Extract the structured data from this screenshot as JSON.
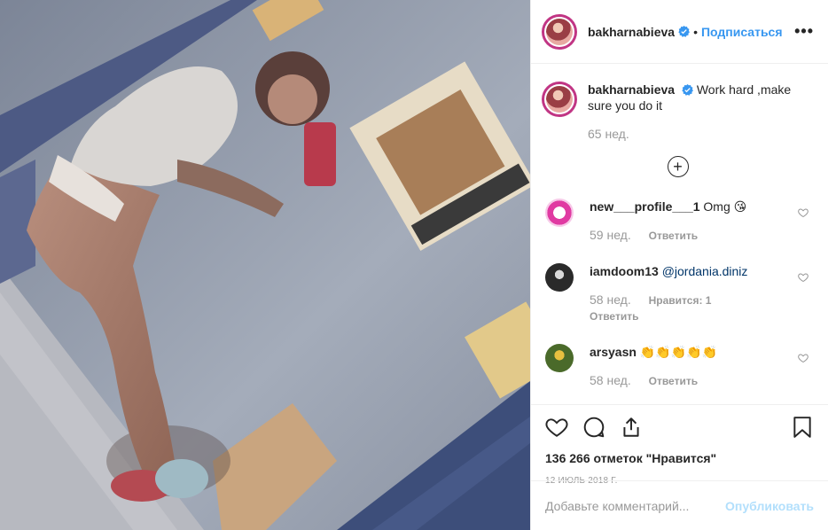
{
  "post": {
    "author": "bakharnabieva",
    "follow_label": "Подписаться",
    "more_label": "•••",
    "separator": "•",
    "caption": "Work hard ,make sure you do it",
    "caption_time": "65 нед.",
    "load_more_label": "+"
  },
  "comments": [
    {
      "user": "new___profile___1",
      "text": "Omg 😘",
      "time": "59 нед.",
      "reply_label": "Ответить",
      "likes_label": "",
      "avatar_color": "#e03aa2"
    },
    {
      "user": "iamdoom13",
      "text": "@jordania.diniz",
      "time": "58 нед.",
      "reply_label": "Ответить",
      "likes_label": "Нравится: 1",
      "avatar_color": "#2a2a2a"
    },
    {
      "user": "arsyasn",
      "text": "👏👏👏👏👏",
      "time": "58 нед.",
      "reply_label": "Ответить",
      "likes_label": "",
      "avatar_color": "#4a6a2a"
    }
  ],
  "footer": {
    "likes": "136 266 отметок \"Нравится\"",
    "date": "12 ИЮЛЬ 2018 Г.",
    "comment_placeholder": "Добавьте комментарий...",
    "publish_label": "Опубликовать"
  },
  "colors": {
    "link": "#3897f0",
    "muted": "#999999",
    "border": "#efefef",
    "publish_disabled": "#b2dffc",
    "verified": "#3897f0"
  },
  "icons": [
    "verified-badge-icon",
    "more-options-icon",
    "plus-circle-icon",
    "heart-icon",
    "comment-icon",
    "share-icon",
    "bookmark-icon"
  ]
}
